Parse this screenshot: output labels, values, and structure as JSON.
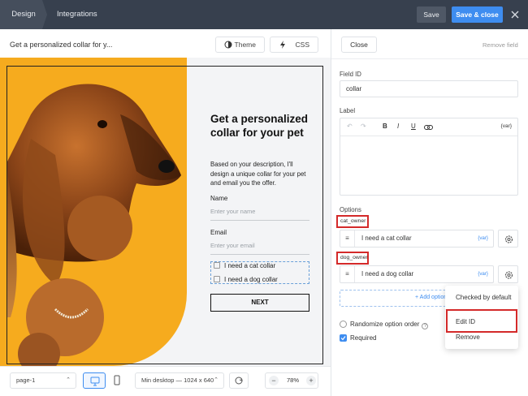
{
  "topbar": {
    "tabs": [
      {
        "label": "Design",
        "active": true
      },
      {
        "label": "Integrations",
        "active": false
      }
    ],
    "save_label": "Save",
    "save_close_label": "Save & close",
    "accent": "#3e8df0",
    "background": "#37404e"
  },
  "editor_header": {
    "title": "Get a personalized collar for y...",
    "theme_label": "Theme",
    "css_label": "CSS"
  },
  "preview": {
    "brand_color": "#f6ab1e",
    "heading": "Get a personalized collar for your pet",
    "description": "Based on your description, I'll design a unique collar for your pet and email you the offer.",
    "fields": [
      {
        "label": "Name",
        "placeholder": "Enter your name"
      },
      {
        "label": "Email",
        "placeholder": "Enter your email"
      }
    ],
    "options": [
      "I need a cat collar",
      "I need a dog collar"
    ],
    "submit_label": "NEXT"
  },
  "bottombar": {
    "page_select": "page-1",
    "breakpoint_select": "Min desktop — 1024 x 640",
    "zoom": "78%",
    "zoom_minus": "−",
    "zoom_plus": "+"
  },
  "right_panel": {
    "close_label": "Close",
    "remove_field_label": "Remove field",
    "field_id_label": "Field ID",
    "field_id_value": "collar",
    "label_label": "Label",
    "label_toolbar": {
      "bold": "B",
      "italic": "I",
      "underline": "U",
      "var": "{var}"
    },
    "options_label": "Options",
    "options": [
      {
        "id": "cat_owner",
        "text": "I need a cat collar",
        "var": "{var}"
      },
      {
        "id": "dog_owner",
        "text": "I need a dog collar",
        "var": "{var}"
      }
    ],
    "add_option_label": "+ Add option",
    "randomize_label": "Randomize option order",
    "required_label": "Required",
    "context_menu": [
      "Checked by default",
      "Edit ID",
      "Remove"
    ],
    "highlight_color": "#d42a2a"
  }
}
